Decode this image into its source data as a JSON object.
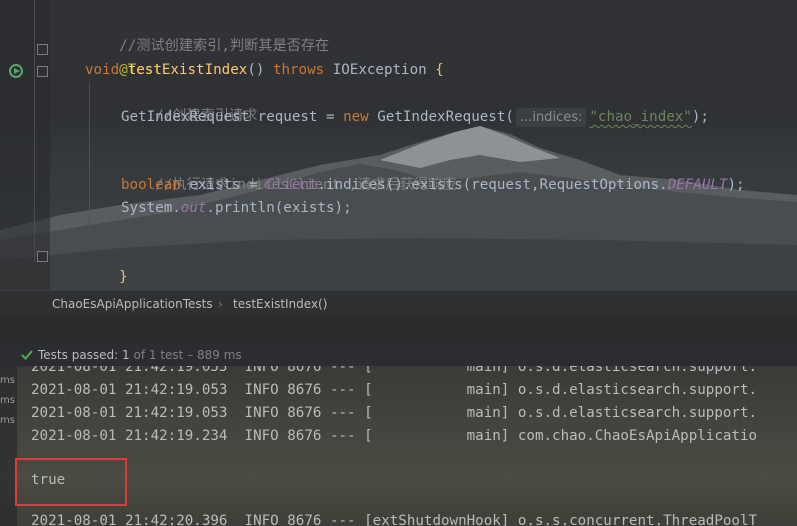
{
  "editor": {
    "lines": {
      "comment1": "//测试创建索引,判断其是否存在",
      "annotation": "@Test",
      "l3_kw_void": "void",
      "l3_fn": "testExistIndex",
      "l3_parens": "() ",
      "l3_kw_throws": "throws",
      "l3_exc": " IOException ",
      "l3_brace": "{",
      "comment2": "//创建索引请求",
      "l5_decl": "GetIndexRequest request = ",
      "l5_new": "new",
      "l5_ctor": " GetIndexRequest(",
      "l5_hint": "...indices:",
      "l5_str": "\"chao_index\"",
      "l5_end": ");",
      "comment3": "//执行请求indicesClient ,请求后获得响应",
      "l7_kw": "boolean",
      "l7_a": " exists = ",
      "l7_client": "Client",
      "l7_b": ".indices().exists(request,RequestOptions.",
      "l7_default": "DEFAULT",
      "l7_end": ");",
      "l8_a": "System.",
      "l8_out": "out",
      "l8_b": ".println(exists);",
      "close_brace": "}"
    }
  },
  "breadcrumb": {
    "class_name": "ChaoEsApiApplicationTests",
    "separator": "›",
    "method_name": "testExistIndex()"
  },
  "test_status": {
    "passed_label": "Tests passed: 1",
    "rest": " of 1 test – 889 ms"
  },
  "console": {
    "gutter_labels": [
      "ms",
      "ms",
      "ms"
    ],
    "lines": [
      "2021-08-01 21:42:19.053  INFO 8676 --- [           main] o.s.d.elasticsearch.support.",
      "2021-08-01 21:42:19.053  INFO 8676 --- [           main] o.s.d.elasticsearch.support.",
      "2021-08-01 21:42:19.053  INFO 8676 --- [           main] o.s.d.elasticsearch.support.",
      "2021-08-01 21:42:19.234  INFO 8676 --- [           main] com.chao.ChaoEsApiApplicatio",
      "2021-08-01 21:42:20.396  INFO 8676 --- [extShutdownHook] o.s.s.concurrent.ThreadPoolT"
    ],
    "output": "true"
  },
  "colors": {
    "highlight": "#e03a3a",
    "pass_check": "#4caf50"
  }
}
